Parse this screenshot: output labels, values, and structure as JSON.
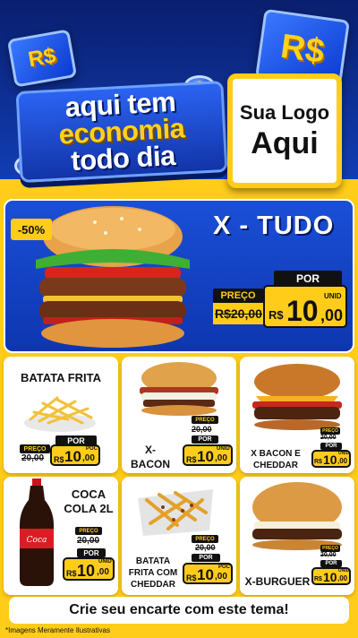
{
  "header": {
    "coin_left": "R$",
    "coin_right": "R$",
    "coin_small": "$",
    "slogan_line1": "aqui tem",
    "slogan_line2": "economia",
    "slogan_line3": "todo dia",
    "logo_line1": "Sua Logo",
    "logo_line2": "Aqui"
  },
  "featured": {
    "discount": "-50%",
    "title": "X - TUDO",
    "por_label": "POR",
    "preco_label": "PREÇO",
    "old_price": "R$20,00",
    "currency": "R$",
    "price_int": "10",
    "price_dec": ",00",
    "unit": "UNID"
  },
  "products": [
    {
      "name": "BATATA FRITA",
      "preco_label": "PREÇO",
      "old_price": "20,00",
      "por_label": "POR",
      "currency": "R$",
      "price_int": "10",
      "price_dec": ",00",
      "unit": "POC"
    },
    {
      "name_line1": "X-",
      "name_line2": "BACON",
      "preco_label": "PREÇO",
      "old_price": "20,00",
      "por_label": "POR",
      "currency": "R$",
      "price_int": "10",
      "price_dec": ",00",
      "unit": "UNID"
    },
    {
      "name_line1": "X BACON E",
      "name_line2": "CHEDDAR",
      "preco_label": "PREÇO",
      "old_price": "20,00",
      "por_label": "POR",
      "currency": "R$",
      "price_int": "10",
      "price_dec": ",00",
      "unit": "UNID"
    },
    {
      "name_line1": "COCA",
      "name_line2": "COLA 2L",
      "preco_label": "PREÇO",
      "old_price": "20,00",
      "por_label": "POR",
      "currency": "R$",
      "price_int": "10",
      "price_dec": ",00",
      "unit": "UNID"
    },
    {
      "name_line1": "BATATA",
      "name_line2": "FRITA COM",
      "name_line3": "CHEDDAR",
      "preco_label": "PREÇO",
      "old_price": "20,00",
      "por_label": "POR",
      "currency": "R$",
      "price_int": "10",
      "price_dec": ",00",
      "unit": "POC"
    },
    {
      "name": "X-BURGUER",
      "preco_label": "PREÇO",
      "old_price": "20,00",
      "por_label": "POR",
      "currency": "R$",
      "price_int": "10",
      "price_dec": ",00",
      "unit": "UNID"
    }
  ],
  "footer": {
    "cta": "Crie seu encarte com este tema!",
    "disclaimer": "*Imagens Meramente Ilustrativas"
  },
  "colors": {
    "brand_blue": "#1a4fd6",
    "brand_yellow": "#ffcc1a",
    "dark": "#111111"
  }
}
